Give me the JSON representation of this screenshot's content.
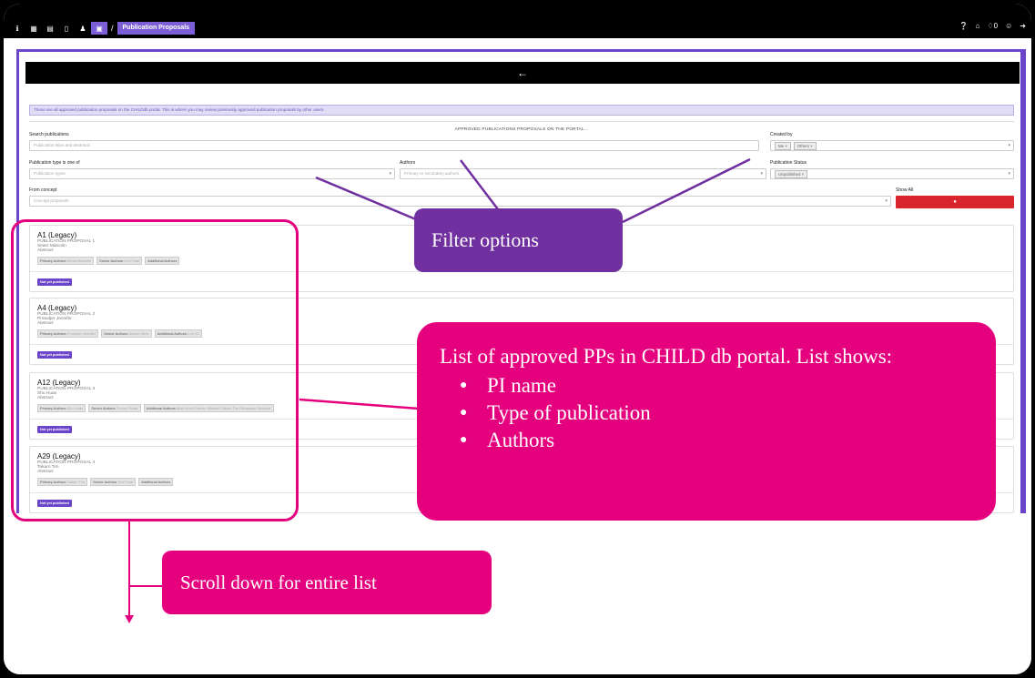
{
  "topbar": {
    "crumb_sep": "/",
    "breadcrumb": "Publication Proposals",
    "left_icons": [
      "info-icon",
      "table-icon",
      "database-icon",
      "file-icon",
      "user-icon",
      "book-icon"
    ],
    "right_icons": [
      "help-icon",
      "home-icon",
      "bell-icon",
      "user-icon",
      "logout-icon"
    ],
    "notification_count": "0"
  },
  "page": {
    "back_arrow": "←",
    "info_text": "These are all approved publication proposals on the CHILDdb portal. This is where you may review previously approved publication proposals by other users.",
    "section_title": "APPROVED PUBLICATIONS PROPOSALS ON THE PORTAL..."
  },
  "filters": {
    "search_label": "Search publications",
    "search_placeholder": "Publication titles and abstracts",
    "created_by_label": "Created by",
    "created_by_chips": [
      "Me ×",
      "Others ×"
    ],
    "pub_type_label": "Publication type is one of",
    "pub_type_placeholder": "Publication types",
    "authors_label": "Authors",
    "authors_placeholder": "Primary or secondary authors",
    "status_label": "Publication Status",
    "status_chips": [
      "Unpublished ×"
    ],
    "concept_label": "From concept",
    "concept_placeholder": "Concept proposals",
    "show_all_label": "Show All",
    "show_all_button": "●"
  },
  "cards": [
    {
      "title": "A1 (Legacy)",
      "proposal": "PUBLICATION PROPOSAL 1",
      "pi": "Sears Malcolm",
      "abstract": "Abstract",
      "authors": [
        {
          "label": "Primary Authors",
          "value": "Sears Malcolm"
        },
        {
          "label": "Senior Authors",
          "value": "Huri Huại"
        },
        {
          "label": "Additional Authors",
          "value": ""
        }
      ],
      "status": "Not yet published"
    },
    {
      "title": "A4 (Legacy)",
      "proposal": "PUBLICATION PROPOSAL 2",
      "pi": "Protudjer Jennifer",
      "abstract": "Abstract",
      "authors": [
        {
          "label": "Primary Authors",
          "value": "Protudjer Jennifer"
        },
        {
          "label": "Senior Authors",
          "value": "Becker Allan"
        },
        {
          "label": "Additional Authors",
          "value": "Luo XZ"
        }
      ],
      "status": "Not yet published"
    },
    {
      "title": "A12 (Legacy)",
      "proposal": "PUBLICATION PROPOSAL 3",
      "pi": "Shu Huan",
      "abstract": "Abstract",
      "authors": [
        {
          "label": "Primary Authors",
          "value": "Shu Huan"
        },
        {
          "label": "Senior Authors",
          "value": "Turvey Stuart"
        },
        {
          "label": "Additional Authors",
          "value": "Allen Koen  Steven Michael  Takaro Tim  Rousseau Nicosine"
        }
      ],
      "status": "Not yet published"
    },
    {
      "title": "A29 (Legacy)",
      "proposal": "PUBLICATION PROPOSAL 4",
      "pi": "Takaro Tim",
      "abstract": "Abstract",
      "authors": [
        {
          "label": "Primary Authors",
          "value": "Takaro Tim"
        },
        {
          "label": "Senior Authors",
          "value": "Huri Huại"
        },
        {
          "label": "Additional Authors",
          "value": ""
        }
      ],
      "status": "Not yet published"
    }
  ],
  "annotations": {
    "filter": "Filter options",
    "list_intro": "List of approved PPs in CHILD db portal. List shows:",
    "list_items": [
      "PI name",
      "Type of publication",
      "Authors"
    ],
    "scroll": "Scroll down for entire list"
  },
  "colors": {
    "accent_purple": "#6a45c9",
    "annotation_purple": "#7030a0",
    "annotation_pink": "#e5007e",
    "show_all_red": "#d9262c"
  }
}
